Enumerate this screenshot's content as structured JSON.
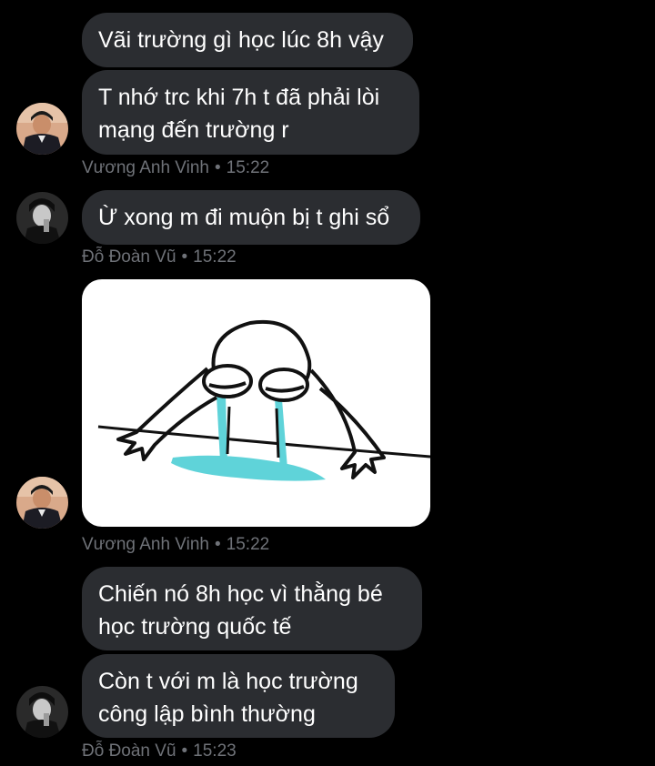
{
  "messages": [
    {
      "text": "Vãi trường gì học lúc 8h vậy"
    },
    {
      "text": "T nhớ trc khi 7h t đã phải lòi\nmạng đến trường r"
    },
    {
      "text": "Ừ xong m đi muộn bị t ghi sổ"
    },
    {
      "text": "Chiến nó 8h học vì thằng bé\nhọc trường quốc tế"
    },
    {
      "text": "Còn t với m là học trường\ncông lập bình thường"
    }
  ],
  "meta": [
    {
      "sender": "Vương Anh Vinh",
      "sep": "•",
      "time": "15:22"
    },
    {
      "sender": "Đỗ Đoàn Vũ",
      "sep": "•",
      "time": "15:22"
    },
    {
      "sender": "Vương Anh Vinh",
      "sep": "•",
      "time": "15:22"
    },
    {
      "sender": "Đỗ Đoàn Vũ",
      "sep": "•",
      "time": "15:23"
    }
  ],
  "colors": {
    "background": "#000000",
    "bubble": "#2b2d31",
    "text": "#ffffff",
    "meta": "#6f7278",
    "tears": "#5fd3d9"
  },
  "icons": {
    "sticker": "crying-cartoon-sticker"
  }
}
